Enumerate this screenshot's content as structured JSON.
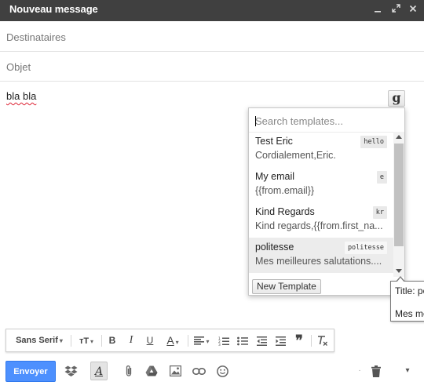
{
  "window": {
    "title": "Nouveau message",
    "controls": [
      "minimize-icon",
      "expand-icon",
      "close-icon"
    ]
  },
  "compose": {
    "recipients_placeholder": "Destinataires",
    "subject_placeholder": "Objet",
    "body_text": "bla bla"
  },
  "extension_button": {
    "label": "g"
  },
  "templates_popup": {
    "search_placeholder": "Search templates...",
    "items": [
      {
        "name": "Test Eric",
        "preview": "Cordialement,Eric.",
        "shortcut": "hello",
        "selected": false
      },
      {
        "name": "My email",
        "preview": "{{from.email}}",
        "shortcut": "e",
        "selected": false
      },
      {
        "name": "Kind Regards",
        "preview": "Kind regards,{{from.first_na...",
        "shortcut": "kr",
        "selected": false
      },
      {
        "name": "politesse",
        "preview": "Mes meilleures salutations....",
        "shortcut": "politesse",
        "selected": true
      }
    ],
    "new_template_label": "New Template"
  },
  "tooltip": {
    "line1": "Title: po",
    "line2": "Mes me"
  },
  "format_toolbar": {
    "font_family_label": "Sans Serif",
    "font_size_icon": "text-size-icon",
    "bold": "B",
    "italic": "I",
    "underline": "U",
    "text_color": "A",
    "align_icon": "align-icon",
    "numbered_list_icon": "numbered-list-icon",
    "bulleted_list_icon": "bulleted-list-icon",
    "indent_less_icon": "indent-less-icon",
    "indent_more_icon": "indent-more-icon",
    "quote": "❞",
    "remove_formatting_icon": "remove-formatting-icon"
  },
  "send_toolbar": {
    "send_label": "Envoyer",
    "icons": [
      "dropbox-icon",
      "formatting-icon",
      "attach-icon",
      "drive-icon",
      "photo-icon",
      "link-icon",
      "emoji-icon",
      "trash-icon",
      "more-options-icon"
    ]
  },
  "colors": {
    "titlebar_bg": "#404040",
    "send_button_bg": "#4d90fe",
    "selected_template_bg": "#ececec"
  }
}
